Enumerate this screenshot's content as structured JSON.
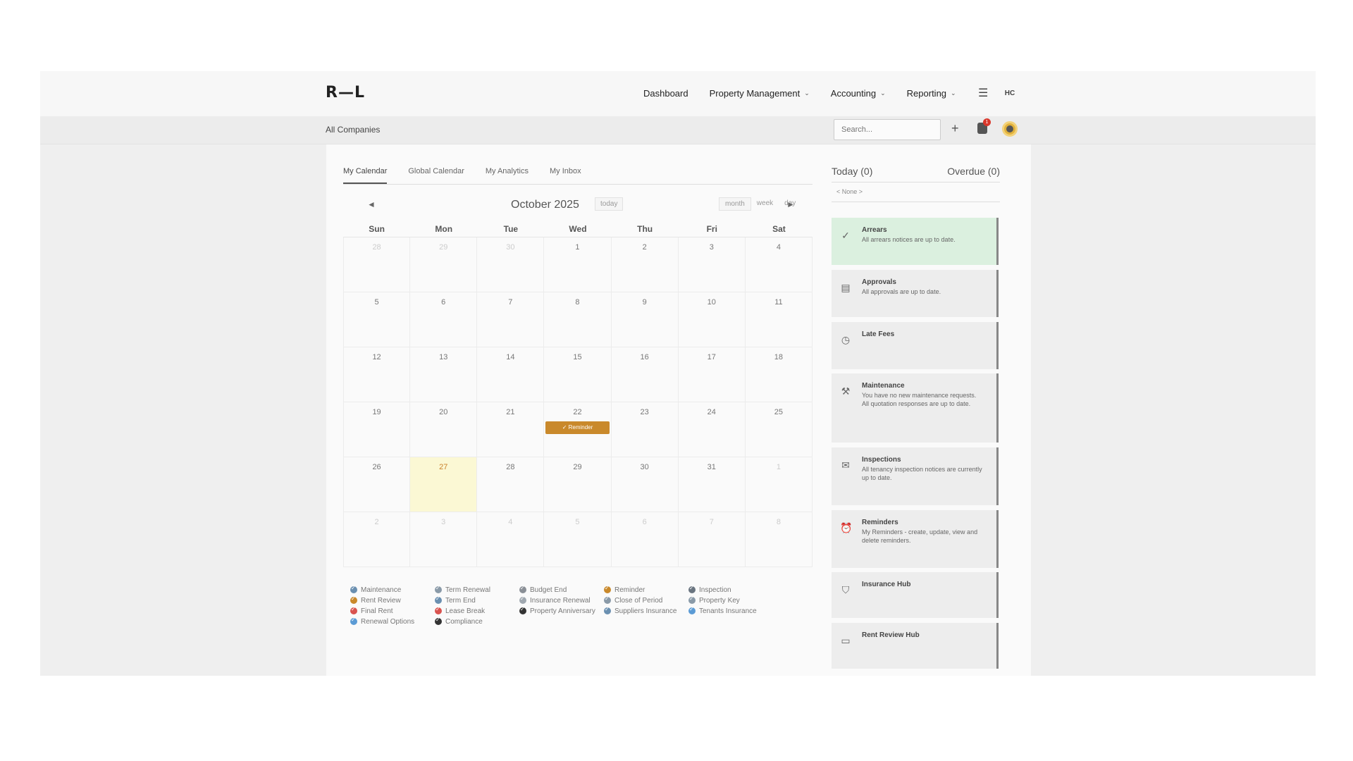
{
  "app": {
    "logo": "R—L"
  },
  "nav": {
    "items": [
      {
        "label": "Dashboard",
        "has_dropdown": false
      },
      {
        "label": "Property Management",
        "has_dropdown": true
      },
      {
        "label": "Accounting",
        "has_dropdown": true
      },
      {
        "label": "Reporting",
        "has_dropdown": true
      }
    ],
    "menu_icon": "hamburger-icon",
    "user_initials": "HC"
  },
  "subbar": {
    "company": "All Companies",
    "search_placeholder": "Search...",
    "notification_count": "1"
  },
  "tabs": [
    {
      "label": "My Calendar",
      "active": true
    },
    {
      "label": "Global Calendar",
      "active": false
    },
    {
      "label": "My Analytics",
      "active": false
    },
    {
      "label": "My Inbox",
      "active": false
    }
  ],
  "calendar": {
    "title": "October 2025",
    "today_label": "today",
    "views": [
      {
        "label": "month",
        "active": true
      },
      {
        "label": "week",
        "active": false
      },
      {
        "label": "day",
        "active": false
      }
    ],
    "days_of_week": [
      "Sun",
      "Mon",
      "Tue",
      "Wed",
      "Thu",
      "Fri",
      "Sat"
    ],
    "weeks": [
      [
        {
          "d": "28",
          "o": true
        },
        {
          "d": "29",
          "o": true
        },
        {
          "d": "30",
          "o": true
        },
        {
          "d": "1"
        },
        {
          "d": "2"
        },
        {
          "d": "3"
        },
        {
          "d": "4"
        }
      ],
      [
        {
          "d": "5"
        },
        {
          "d": "6"
        },
        {
          "d": "7"
        },
        {
          "d": "8"
        },
        {
          "d": "9"
        },
        {
          "d": "10"
        },
        {
          "d": "11"
        }
      ],
      [
        {
          "d": "12"
        },
        {
          "d": "13"
        },
        {
          "d": "14"
        },
        {
          "d": "15"
        },
        {
          "d": "16"
        },
        {
          "d": "17"
        },
        {
          "d": "18"
        }
      ],
      [
        {
          "d": "19"
        },
        {
          "d": "20"
        },
        {
          "d": "21"
        },
        {
          "d": "22",
          "event": "✓ Reminder"
        },
        {
          "d": "23"
        },
        {
          "d": "24"
        },
        {
          "d": "25"
        }
      ],
      [
        {
          "d": "26"
        },
        {
          "d": "27",
          "today": true
        },
        {
          "d": "28"
        },
        {
          "d": "29"
        },
        {
          "d": "30"
        },
        {
          "d": "31"
        },
        {
          "d": "1",
          "o": true
        }
      ],
      [
        {
          "d": "2",
          "o": true
        },
        {
          "d": "3",
          "o": true
        },
        {
          "d": "4",
          "o": true
        },
        {
          "d": "5",
          "o": true
        },
        {
          "d": "6",
          "o": true
        },
        {
          "d": "7",
          "o": true
        },
        {
          "d": "8",
          "o": true
        }
      ]
    ]
  },
  "legend": [
    [
      {
        "label": "Maintenance",
        "color": "#6a8fb0"
      },
      {
        "label": "Rent Review",
        "color": "#c9892b"
      },
      {
        "label": "Final Rent",
        "color": "#d9534f"
      },
      {
        "label": "Renewal Options",
        "color": "#5b9bd5"
      }
    ],
    [
      {
        "label": "Term Renewal",
        "color": "#8a9aa8"
      },
      {
        "label": "Term End",
        "color": "#6a8fb0"
      },
      {
        "label": "Lease Break",
        "color": "#d9534f"
      },
      {
        "label": "Compliance",
        "color": "#333333"
      }
    ],
    [
      {
        "label": "Budget End",
        "color": "#8a8f96"
      },
      {
        "label": "Insurance Renewal",
        "color": "#a0a8b0"
      },
      {
        "label": "Property Anniversary",
        "color": "#333333"
      }
    ],
    [
      {
        "label": "Reminder",
        "color": "#c9892b"
      },
      {
        "label": "Close of Period",
        "color": "#8a9aa8"
      },
      {
        "label": "Suppliers Insurance",
        "color": "#6a8fb0"
      }
    ],
    [
      {
        "label": "Inspection",
        "color": "#6a7580"
      },
      {
        "label": "Property Key",
        "color": "#8a9aa8"
      },
      {
        "label": "Tenants Insurance",
        "color": "#5b9bd5"
      }
    ]
  ],
  "side": {
    "today_label": "Today (0)",
    "overdue_label": "Overdue (0)",
    "none_label": "< None >",
    "cards": [
      {
        "title": "Arrears",
        "body": "All arrears notices are up to date.",
        "icon": "check-circle-icon",
        "highlight": true
      },
      {
        "title": "Approvals",
        "body": "All approvals are up to date.",
        "icon": "document-icon"
      },
      {
        "title": "Late Fees",
        "body": "",
        "icon": "clock-icon"
      },
      {
        "title": "Maintenance",
        "body": "You have no new maintenance requests.\nAll quotation responses are up to date.",
        "icon": "tools-icon"
      },
      {
        "title": "Inspections",
        "body": "All tenancy inspection notices are currently up to date.",
        "icon": "envelope-icon"
      },
      {
        "title": "Reminders",
        "body": "My Reminders - create, update, view and delete reminders.",
        "icon": "alarm-clock-icon"
      },
      {
        "title": "Insurance Hub",
        "body": "",
        "icon": "shield-icon"
      },
      {
        "title": "Rent Review Hub",
        "body": "",
        "icon": "card-icon"
      }
    ]
  }
}
